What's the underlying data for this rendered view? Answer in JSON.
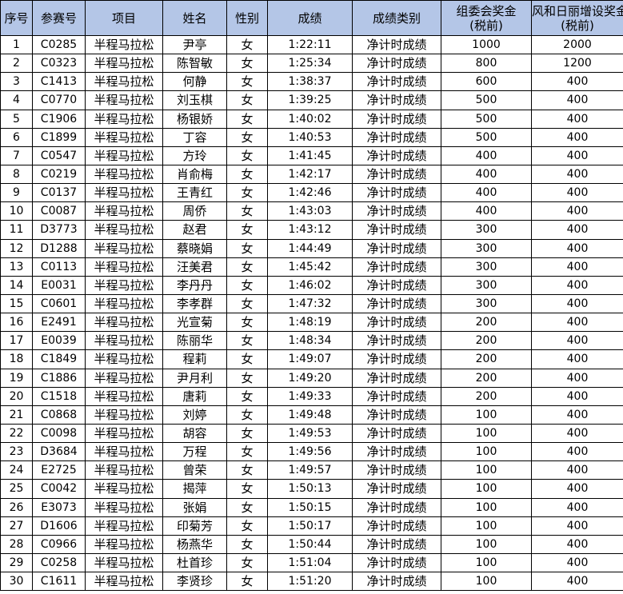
{
  "table": {
    "headers": [
      {
        "l1": "序号",
        "l2": ""
      },
      {
        "l1": "参赛号",
        "l2": ""
      },
      {
        "l1": "项目",
        "l2": ""
      },
      {
        "l1": "姓名",
        "l2": ""
      },
      {
        "l1": "性别",
        "l2": ""
      },
      {
        "l1": "成绩",
        "l2": ""
      },
      {
        "l1": "成绩类别",
        "l2": ""
      },
      {
        "l1": "组委会奖金",
        "l2": "(税前)"
      },
      {
        "l1": "风和日丽增设奖金",
        "l2": "(税前)"
      }
    ],
    "rows": [
      [
        "1",
        "C0285",
        "半程马拉松",
        "尹亭",
        "女",
        "1:22:11",
        "净计时成绩",
        "1000",
        "2000"
      ],
      [
        "2",
        "C0323",
        "半程马拉松",
        "陈智敏",
        "女",
        "1:25:34",
        "净计时成绩",
        "800",
        "1200"
      ],
      [
        "3",
        "C1413",
        "半程马拉松",
        "何静",
        "女",
        "1:38:37",
        "净计时成绩",
        "600",
        "400"
      ],
      [
        "4",
        "C0770",
        "半程马拉松",
        "刘玉棋",
        "女",
        "1:39:25",
        "净计时成绩",
        "500",
        "400"
      ],
      [
        "5",
        "C1906",
        "半程马拉松",
        "杨银娇",
        "女",
        "1:40:02",
        "净计时成绩",
        "500",
        "400"
      ],
      [
        "6",
        "C1899",
        "半程马拉松",
        "丁容",
        "女",
        "1:40:53",
        "净计时成绩",
        "500",
        "400"
      ],
      [
        "7",
        "C0547",
        "半程马拉松",
        "方玲",
        "女",
        "1:41:45",
        "净计时成绩",
        "400",
        "400"
      ],
      [
        "8",
        "C0219",
        "半程马拉松",
        "肖俞梅",
        "女",
        "1:42:17",
        "净计时成绩",
        "400",
        "400"
      ],
      [
        "9",
        "C0137",
        "半程马拉松",
        "王青红",
        "女",
        "1:42:46",
        "净计时成绩",
        "400",
        "400"
      ],
      [
        "10",
        "C0087",
        "半程马拉松",
        "周侨",
        "女",
        "1:43:03",
        "净计时成绩",
        "400",
        "400"
      ],
      [
        "11",
        "D3773",
        "半程马拉松",
        "赵君",
        "女",
        "1:43:12",
        "净计时成绩",
        "300",
        "400"
      ],
      [
        "12",
        "D1288",
        "半程马拉松",
        "蔡晓娟",
        "女",
        "1:44:49",
        "净计时成绩",
        "300",
        "400"
      ],
      [
        "13",
        "C0113",
        "半程马拉松",
        "汪美君",
        "女",
        "1:45:42",
        "净计时成绩",
        "300",
        "400"
      ],
      [
        "14",
        "E0031",
        "半程马拉松",
        "李丹丹",
        "女",
        "1:46:02",
        "净计时成绩",
        "300",
        "400"
      ],
      [
        "15",
        "C0601",
        "半程马拉松",
        "李孝群",
        "女",
        "1:47:32",
        "净计时成绩",
        "300",
        "400"
      ],
      [
        "16",
        "E2491",
        "半程马拉松",
        "光宣菊",
        "女",
        "1:48:19",
        "净计时成绩",
        "200",
        "400"
      ],
      [
        "17",
        "E0039",
        "半程马拉松",
        "陈丽华",
        "女",
        "1:48:34",
        "净计时成绩",
        "200",
        "400"
      ],
      [
        "18",
        "C1849",
        "半程马拉松",
        "程莉",
        "女",
        "1:49:07",
        "净计时成绩",
        "200",
        "400"
      ],
      [
        "19",
        "C1886",
        "半程马拉松",
        "尹月利",
        "女",
        "1:49:20",
        "净计时成绩",
        "200",
        "400"
      ],
      [
        "20",
        "C1518",
        "半程马拉松",
        "唐莉",
        "女",
        "1:49:33",
        "净计时成绩",
        "200",
        "400"
      ],
      [
        "21",
        "C0868",
        "半程马拉松",
        "刘婷",
        "女",
        "1:49:48",
        "净计时成绩",
        "100",
        "400"
      ],
      [
        "22",
        "C0098",
        "半程马拉松",
        "胡容",
        "女",
        "1:49:53",
        "净计时成绩",
        "100",
        "400"
      ],
      [
        "23",
        "D3684",
        "半程马拉松",
        "万程",
        "女",
        "1:49:56",
        "净计时成绩",
        "100",
        "400"
      ],
      [
        "24",
        "E2725",
        "半程马拉松",
        "曾荣",
        "女",
        "1:49:57",
        "净计时成绩",
        "100",
        "400"
      ],
      [
        "25",
        "C0042",
        "半程马拉松",
        "揭萍",
        "女",
        "1:50:13",
        "净计时成绩",
        "100",
        "400"
      ],
      [
        "26",
        "E3073",
        "半程马拉松",
        "张娟",
        "女",
        "1:50:15",
        "净计时成绩",
        "100",
        "400"
      ],
      [
        "27",
        "D1606",
        "半程马拉松",
        "印菊芳",
        "女",
        "1:50:17",
        "净计时成绩",
        "100",
        "400"
      ],
      [
        "28",
        "C0966",
        "半程马拉松",
        "杨燕华",
        "女",
        "1:50:44",
        "净计时成绩",
        "100",
        "400"
      ],
      [
        "29",
        "C0258",
        "半程马拉松",
        "杜首珍",
        "女",
        "1:51:04",
        "净计时成绩",
        "100",
        "400"
      ],
      [
        "30",
        "C1611",
        "半程马拉松",
        "李贤珍",
        "女",
        "1:51:20",
        "净计时成绩",
        "100",
        "400"
      ]
    ]
  },
  "colors": {
    "header_bg": "#b4c6e7",
    "border": "#000000"
  }
}
